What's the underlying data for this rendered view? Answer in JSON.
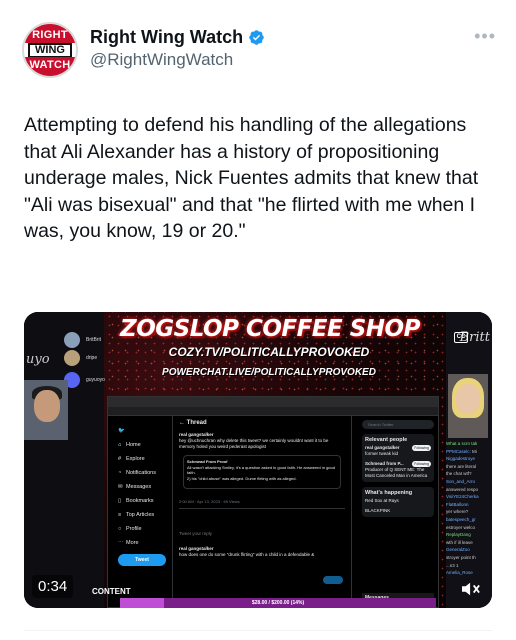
{
  "account": {
    "display_name": "Right Wing Watch",
    "handle": "@RightWingWatch",
    "logo": {
      "top": "RIGHT",
      "middle": "WING",
      "bottom": "WATCH"
    },
    "verified_icon": "verified-badge-icon",
    "more_icon": "more-options-icon"
  },
  "tweet": {
    "text": "Attempting to defend his handling of the allegations that Ali Alexander has a history of propositioning underage males, Nick Fuentes admits that knew that \"Ali was bisexual\" and that \"he flirted with me when I was, you know, 19 or 20.\""
  },
  "video": {
    "timestamp": "0:34",
    "content_label": "CONTENT",
    "stream_title": "ZOGSLOP COFFEE SHOP",
    "stream_url": "COZY.TV/POLITICALLYPROVOKED",
    "powerchat_url": "POWERCHAT.LIVE/POLITICALLYPROVOKED",
    "script_left": "uyo",
    "script_right": "Britt",
    "gift_goal": "$28.00 / $200.00 (14%)",
    "gift_progress": 0.14,
    "left_chat_users": [
      "BritBrit",
      "dripe",
      "guyuoyo"
    ],
    "right_chat": [
      {
        "user": "What a scrn tak",
        "msg": ""
      },
      {
        "user": "PPMCaselc:",
        "msg": "Mi"
      },
      {
        "user": "Niggadestroye",
        "msg": ""
      },
      {
        "user": "",
        "msg": "there are literal"
      },
      {
        "user": "",
        "msg": "the chat wtf?"
      },
      {
        "user": "Son_and_Arro",
        "msg": ""
      },
      {
        "user": "",
        "msg": "answered respo"
      },
      {
        "user": "VisiYE24Cherka",
        "msg": ""
      },
      {
        "user": "FlatBallonn",
        "msg": ""
      },
      {
        "user": "",
        "msg": "yer where?"
      },
      {
        "user": "batespeech_gr",
        "msg": ""
      },
      {
        "user": "",
        "msg": "estroyer welco"
      },
      {
        "user": "ReplayDang",
        "msg": ""
      },
      {
        "user": "",
        "msg": "wth if ill leave"
      },
      {
        "user": "GeneralZoo",
        "msg": ""
      },
      {
        "user": "",
        "msg": "stroyer point th"
      },
      {
        "user": "",
        "msg": "...n3 1"
      },
      {
        "user": "Amelia_Rose",
        "msg": ""
      }
    ],
    "embedded_twitter": {
      "nav": [
        "Home",
        "Explore",
        "Notifications",
        "Messages",
        "Bookmarks",
        "Top Articles",
        "Profile",
        "More"
      ],
      "tweet_button": "Tweet",
      "thread_header": "Thread",
      "author": "real gangstalker",
      "thread_body": "hey @uchnuchran why delete this tweet? we certainly wouldnt want it to be memory holed you weird pederast apologist",
      "quoted_author": "Schmead From Proof",
      "quoted_body": "Ali wasn't attacking Smiley, it's a question asked in good faith. He answered in good faith.",
      "quoted_body2": "2) his \"child abuse\" was alleged. Dume flirting with as alleged.",
      "meta": "2:00 AM · Apr 13, 2023 · 69 Views",
      "reply_placeholder": "Tweet your reply",
      "reply_label": "Reply",
      "reply_author": "real gangstalker",
      "reply_body": "how does one do some \"drunk flirting\" with a child in a defendable &",
      "search_placeholder": "Search Twitter",
      "relevant_header": "Relevant people",
      "relevant": [
        {
          "name": "real gangstalker",
          "bio": "former tweak kid",
          "follow": "Following"
        },
        {
          "name": "Schmead from P...",
          "bio": "Producer of Q SENT ME: The Most Canceled Man in America",
          "follow": "Following"
        }
      ],
      "happening_header": "What's happening",
      "happening_items": [
        "Red Sox at Rays",
        "BLACKPINK"
      ],
      "messages_label": "Messages"
    }
  }
}
